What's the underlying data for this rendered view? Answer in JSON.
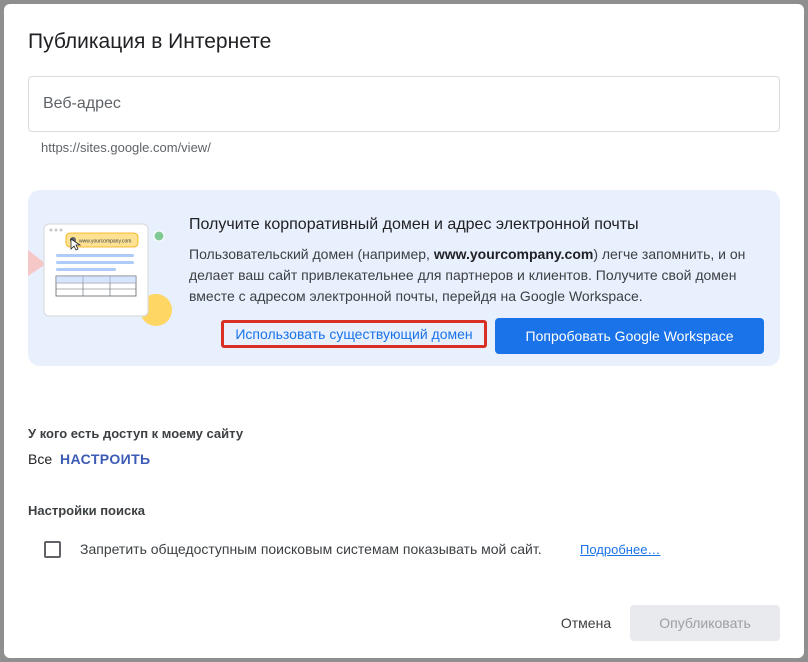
{
  "dialog": {
    "title": "Публикация в Интернете",
    "url_field": {
      "placeholder": "Веб-адрес",
      "value": "",
      "hint": "https://sites.google.com/view/"
    },
    "promo": {
      "title": "Получите корпоративный домен и адрес электронной почты",
      "text_before": "Пользовательский домен (например, ",
      "text_bold": "www.yourcompany.com",
      "text_after": ") легче запомнить, и он делает ваш сайт привлекательнее для партнеров и клиентов. Получите свой домен вместе с адресом электронной почты, перейдя на Google Workspace.",
      "illustration_url": "www.yourcompany.com",
      "existing_domain_label": "Использовать существующий домен",
      "workspace_label": "Попробовать Google Workspace"
    },
    "access": {
      "label": "У кого есть доступ к моему сайту",
      "value": "Все",
      "configure_label": "НАСТРОИТЬ"
    },
    "search": {
      "label": "Настройки поиска",
      "checkbox_label": "Запретить общедоступным поисковым системам показывать мой сайт.",
      "learn_more": "Подробнее…"
    },
    "footer": {
      "cancel_label": "Отмена",
      "publish_label": "Опубликовать"
    }
  },
  "colors": {
    "accent": "#1a73e8",
    "promo_background": "#e8f0fe",
    "highlight_border": "#d93025",
    "disabled_bg": "#e8eaed",
    "disabled_text": "#9aa0a6"
  }
}
